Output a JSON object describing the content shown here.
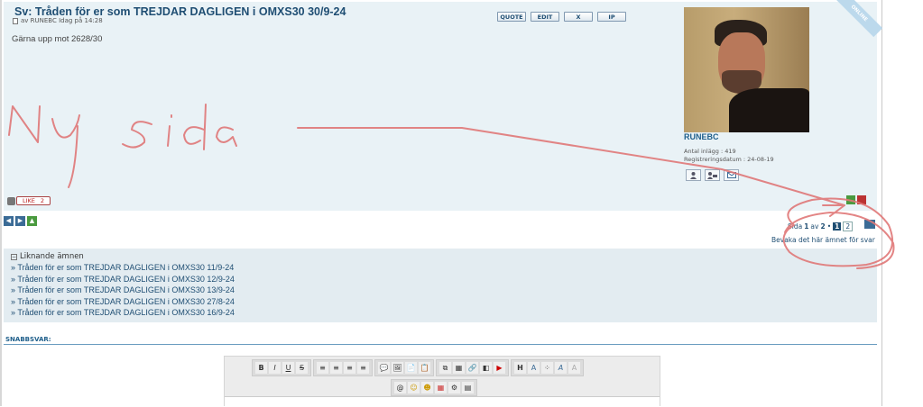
{
  "post": {
    "title": "Sv: Tråden för er som TREJDAR DAGLIGEN i OMXS30 30/9-24",
    "meta": "av RUNEBC Idag på 14:28",
    "body": "Gärna upp mot 2628/30",
    "mod_buttons": [
      "QUOTE",
      "EDIT",
      "X",
      "IP"
    ],
    "online_badge": "ONLINE",
    "like_label": "LIKE",
    "like_count": "2"
  },
  "author": {
    "name": "RUNEBC",
    "posts_label": "Antal inlägg : 419",
    "registered_label": "Registreringsdatum : 24-08-19"
  },
  "pagination": {
    "prefix": "Sida",
    "current": "1",
    "of": "av",
    "total": "2",
    "bullet": "•",
    "page1": "1",
    "page2": "2",
    "watch": "Bevaka det här ämnet för svar"
  },
  "similar": {
    "header": "Liknande ämnen",
    "items": [
      "» Tråden för er som TREJDAR DAGLIGEN i OMXS30 11/9-24",
      "» Tråden för er som TREJDAR DAGLIGEN i OMXS30 12/9-24",
      "» Tråden för er som TREJDAR DAGLIGEN i OMXS30 13/9-24",
      "» Tråden för er som TREJDAR DAGLIGEN i OMXS30 27/8-24",
      "» Tråden för er som TREJDAR DAGLIGEN i OMXS30 16/9-24"
    ]
  },
  "quick_reply": {
    "label": "SNABBSVAR:"
  },
  "editor": {
    "row1": [
      "B",
      "I",
      "U",
      "S",
      "≡",
      "≡",
      "≡",
      "≡",
      "💬",
      "🖼",
      "📄",
      "📋",
      "⧉",
      "▦",
      "🔗",
      "◧",
      "▶",
      "H",
      "A",
      "⁘",
      "A",
      "A"
    ],
    "row2": [
      "@",
      "☺",
      "☻",
      "▦",
      "⚙",
      "▤"
    ]
  },
  "annotation": {
    "text": "Ny sida",
    "color": "#e07070"
  }
}
